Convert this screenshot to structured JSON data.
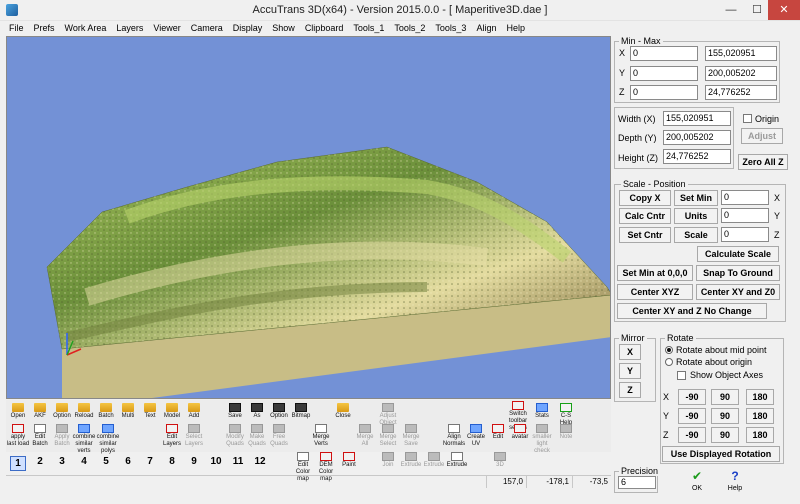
{
  "window": {
    "title": "AccuTrans 3D(x64) - Version 2015.0.0 - [ Maperitive3D.dae ]",
    "minimize": "—",
    "maximize": "☐",
    "close": "✕"
  },
  "menu": [
    "File",
    "Prefs",
    "Work Area",
    "Layers",
    "Viewer",
    "Camera",
    "Display",
    "Show",
    "Clipboard",
    "Tools_1",
    "Tools_2",
    "Tools_3",
    "Align",
    "Help"
  ],
  "viewport": {
    "background_color": "#7391d6",
    "terrain_colors": [
      "#6b8f3a",
      "#a7c35e",
      "#e4dca0",
      "#7c6a3e",
      "#c8bd86"
    ]
  },
  "toolbar": {
    "row1": [
      {
        "label": "Open",
        "icon": "folder-icon"
      },
      {
        "label": "AKF",
        "icon": "folder-icon"
      },
      {
        "label": "Option",
        "icon": "folder-icon"
      },
      {
        "label": "Reload",
        "icon": "folder-icon"
      },
      {
        "label": "Batch",
        "icon": "folder-icon"
      },
      {
        "label": "Multi",
        "icon": "folder-icon"
      },
      {
        "label": "Text",
        "icon": "folder-icon"
      },
      {
        "label": "Model",
        "icon": "folder-icon"
      },
      {
        "label": "Add",
        "icon": "folder-icon"
      },
      {
        "label": "Save",
        "icon": "disk-icon"
      },
      {
        "label": "As",
        "icon": "disk-icon"
      },
      {
        "label": "Option",
        "icon": "disk-icon"
      },
      {
        "label": "Bitmap",
        "icon": "disk-icon"
      },
      {
        "label": "Close",
        "icon": "folder-icon"
      },
      {
        "label": "Switch toolbar setups",
        "icon": "switch-icon"
      },
      {
        "label": "Stats",
        "icon": "stats-icon"
      },
      {
        "label": "C-S Help",
        "icon": "help-icon"
      }
    ],
    "row2": [
      {
        "label": "apply last load",
        "icon": "apply-icon"
      },
      {
        "label": "Edit Batch",
        "icon": "edit-icon"
      },
      {
        "label": "Apply Batch",
        "icon": "apply-batch-icon",
        "disabled": true
      },
      {
        "label": "combine similar verts",
        "icon": "combine-verts-icon"
      },
      {
        "label": "combine similar polys",
        "icon": "combine-polys-icon"
      },
      {
        "label": "Edit Layers",
        "icon": "layers-icon"
      },
      {
        "label": "Select Layers",
        "icon": "select-layers-icon",
        "disabled": true
      },
      {
        "label": "Modify Quads",
        "icon": "modify-quads-icon",
        "disabled": true
      },
      {
        "label": "Make Quads",
        "icon": "make-quads-icon",
        "disabled": true
      },
      {
        "label": "Free Quads",
        "icon": "free-quads-icon",
        "disabled": true
      },
      {
        "label": "Merge Verts",
        "icon": "merge-verts-icon"
      },
      {
        "label": "Merge All",
        "icon": "merge-all-icon",
        "disabled": true
      },
      {
        "label": "Adjust Object",
        "icon": "adjust-object-icon",
        "disabled": true
      },
      {
        "label": "Merge Select",
        "icon": "merge-select-icon",
        "disabled": true
      },
      {
        "label": "Merge Save",
        "icon": "merge-save-icon",
        "disabled": true
      },
      {
        "label": "Align Normals",
        "icon": "align-normals-icon"
      },
      {
        "label": "Create UV",
        "icon": "uv-icon"
      },
      {
        "label": "Edit",
        "icon": "edit-red-icon"
      },
      {
        "label": "avatar",
        "icon": "avatar-icon"
      },
      {
        "label": "smaller light check",
        "icon": "light-icon",
        "disabled": true
      },
      {
        "label": "Note",
        "icon": "note-icon",
        "disabled": true
      }
    ],
    "row3": [
      {
        "label": "Edit Color map",
        "icon": "color-map-icon"
      },
      {
        "label": "DEM Color map",
        "icon": "dem-icon"
      },
      {
        "label": "Paint",
        "icon": "paint-icon"
      },
      {
        "label": "Join",
        "icon": "join-icon",
        "disabled": true
      },
      {
        "label": "Extrude",
        "icon": "extrude-icon",
        "disabled": true
      },
      {
        "label": "Extrude",
        "icon": "extrude-icon",
        "disabled": true
      },
      {
        "label": "Extrude",
        "icon": "extrude-icon"
      },
      {
        "label": "3D",
        "icon": "3d-icon",
        "disabled": true
      }
    ]
  },
  "layers": [
    "1",
    "2",
    "3",
    "4",
    "5",
    "6",
    "7",
    "8",
    "9",
    "10",
    "11",
    "12"
  ],
  "status": {
    "v1": "157,0",
    "v2": "-178,1",
    "v3": "-73,5"
  },
  "minmax": {
    "legend": "Min - Max",
    "rows": [
      {
        "axis": "X",
        "min": "0",
        "max": "155,020951"
      },
      {
        "axis": "Y",
        "min": "0",
        "max": "200,005202"
      },
      {
        "axis": "Z",
        "min": "0",
        "max": "24,776252"
      }
    ]
  },
  "dims": {
    "width_label": "Width (X)",
    "width": "155,020951",
    "depth_label": "Depth (Y)",
    "depth": "200,005202",
    "height_label": "Height (Z)",
    "height": "24,776252",
    "origin": "Origin",
    "adjust": "Adjust",
    "zero_all": "Zero All Z"
  },
  "scale": {
    "legend": "Scale - Position",
    "copy_x": "Copy X",
    "set_min": "Set Min",
    "calc_cntr": "Calc Cntr",
    "units": "Units",
    "set_cntr": "Set Cntr",
    "scale": "Scale",
    "x_val": "0",
    "y_val": "0",
    "z_val": "0",
    "x": "X",
    "y": "Y",
    "z": "Z",
    "calculate_scale": "Calculate Scale",
    "set_min_000": "Set Min at 0,0,0",
    "snap_ground": "Snap To Ground",
    "center_xyz": "Center XYZ",
    "center_xy_z0": "Center XY and Z0",
    "center_xyz_nochange": "Center XY and Z No Change"
  },
  "mirror": {
    "legend": "Mirror",
    "x": "X",
    "y": "Y",
    "z": "Z"
  },
  "rotate": {
    "legend": "Rotate",
    "about_mid": "Rotate about mid point",
    "about_origin": "Rotate about origin",
    "show_axes": "Show Object Axes",
    "rows": [
      {
        "axis": "X",
        "a": "-90",
        "b": "90",
        "c": "180"
      },
      {
        "axis": "Y",
        "a": "-90",
        "b": "90",
        "c": "180"
      },
      {
        "axis": "Z",
        "a": "-90",
        "b": "90",
        "c": "180"
      }
    ],
    "use_displayed": "Use Displayed Rotation"
  },
  "precision": {
    "legend": "Precision",
    "value": "6"
  },
  "footer": {
    "ok": "OK",
    "help": "Help"
  }
}
